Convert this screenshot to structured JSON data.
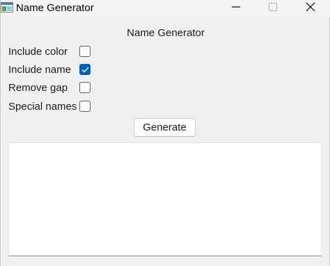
{
  "window": {
    "title": "Name Generator",
    "controls": {
      "minimize": "minimize-icon",
      "maximize": "maximize-icon",
      "close": "close-icon"
    }
  },
  "main": {
    "heading": "Name Generator",
    "options": [
      {
        "label": "Include color",
        "checked": false
      },
      {
        "label": "Include name",
        "checked": true
      },
      {
        "label": "Remove gap",
        "checked": false
      },
      {
        "label": "Special names",
        "checked": false
      }
    ],
    "generate_label": "Generate",
    "output_text": ""
  },
  "colors": {
    "accent": "#005fb8",
    "background": "#f0f0f0",
    "output_background": "#ffffff"
  }
}
